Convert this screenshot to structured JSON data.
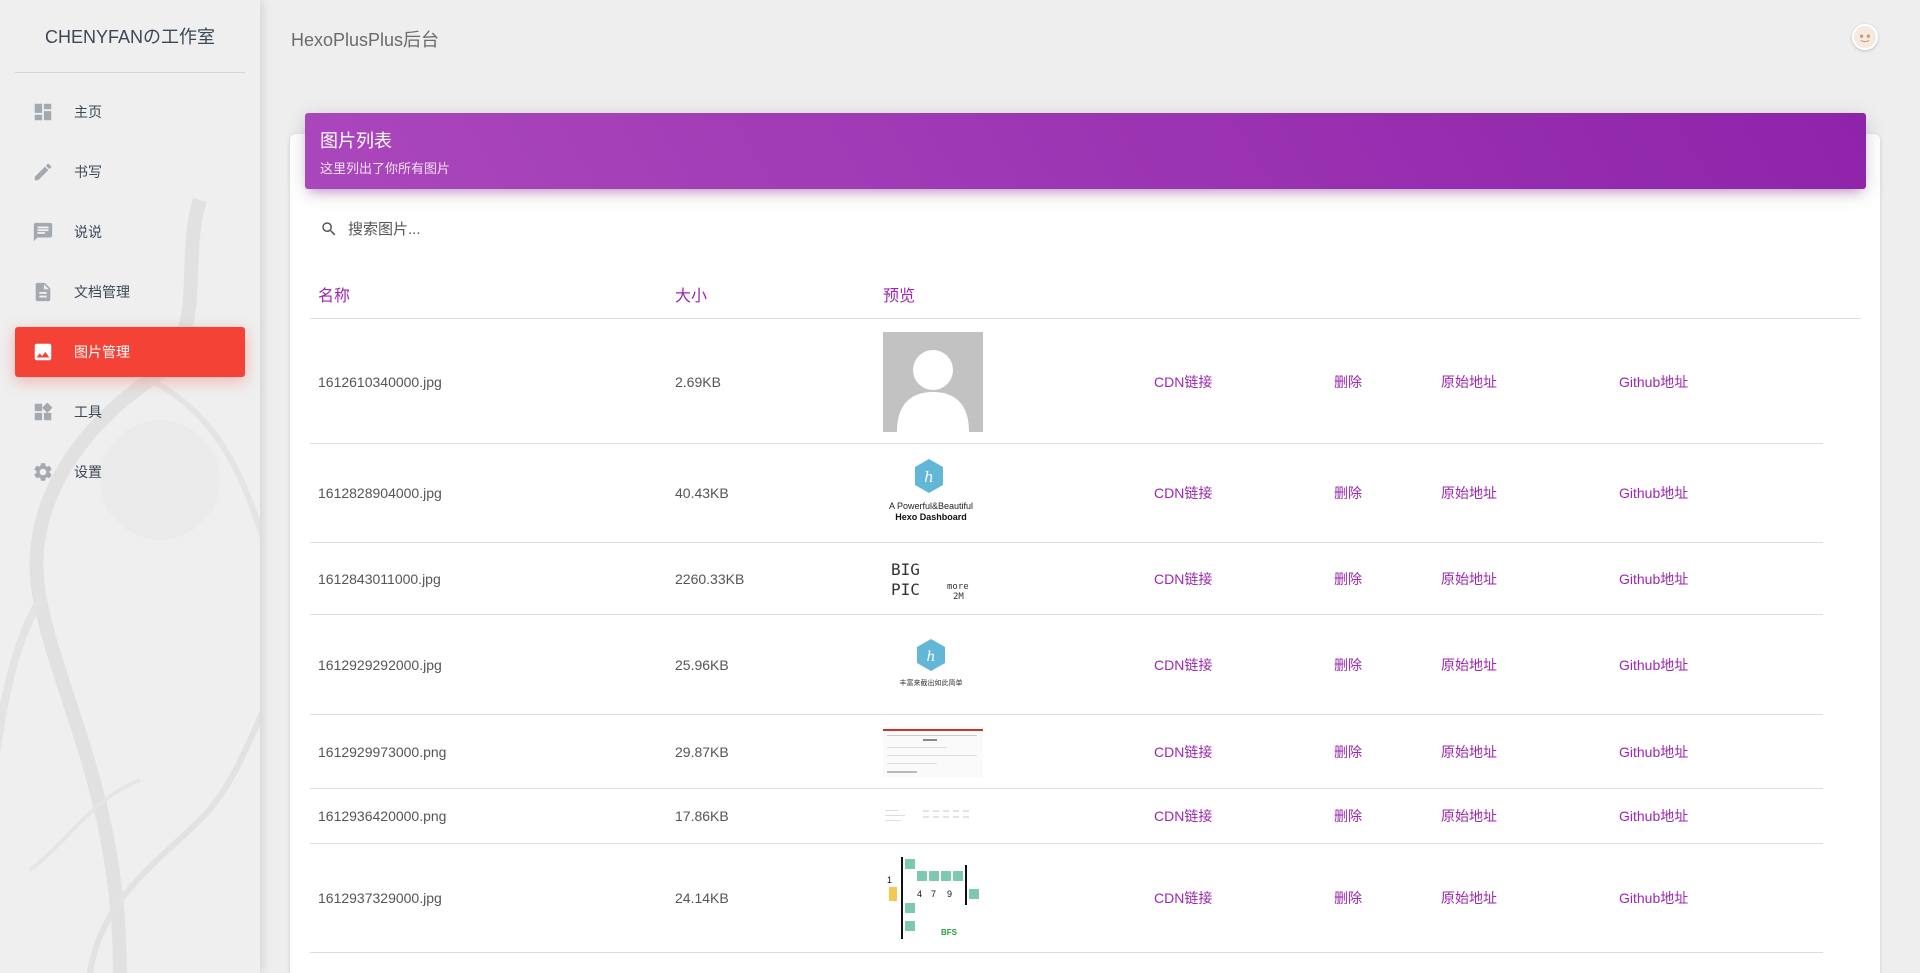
{
  "brand": "CHENYFANの工作室",
  "topbar": {
    "title": "HexoPlusPlus后台"
  },
  "nav": [
    {
      "label": "主页",
      "icon": "dashboard-icon"
    },
    {
      "label": "书写",
      "icon": "pencil-icon"
    },
    {
      "label": "说说",
      "icon": "chat-icon"
    },
    {
      "label": "文档管理",
      "icon": "document-icon"
    },
    {
      "label": "图片管理",
      "icon": "image-icon",
      "active": true
    },
    {
      "label": "工具",
      "icon": "widgets-icon"
    },
    {
      "label": "设置",
      "icon": "gear-icon"
    }
  ],
  "card": {
    "title": "图片列表",
    "subtitle": "这里列出了你所有图片",
    "search_placeholder": "搜索图片...",
    "columns": [
      "名称",
      "大小",
      "预览"
    ],
    "action_labels": {
      "cdn": "CDN链接",
      "delete": "删除",
      "origin": "原始地址",
      "github": "Github地址"
    },
    "rows": [
      {
        "name": "1612610340000.jpg",
        "size": "2.69KB",
        "preview": "default-avatar"
      },
      {
        "name": "1612828904000.jpg",
        "size": "40.43KB",
        "preview": "hexo-dashboard-logo",
        "preview_text": [
          "A Powerful&Beautiful",
          "Hexo Dashboard"
        ]
      },
      {
        "name": "1612843011000.jpg",
        "size": "2260.33KB",
        "preview": "big-pic-handwriting",
        "preview_text": [
          "BIG",
          "PIC",
          "more",
          "2M"
        ]
      },
      {
        "name": "1612929292000.jpg",
        "size": "25.96KB",
        "preview": "hexo-logo-small",
        "preview_text": [
          "丰富来截出如此简单"
        ]
      },
      {
        "name": "1612929973000.png",
        "size": "29.87KB",
        "preview": "screenshot-thumbnail"
      },
      {
        "name": "1612936420000.png",
        "size": "17.86KB",
        "preview": "screenshot-thumbnail-light"
      },
      {
        "name": "1612937329000.jpg",
        "size": "24.14KB",
        "preview": "bfs-diagram",
        "preview_text": [
          "1",
          "4",
          "7",
          "9",
          "BFS"
        ]
      }
    ]
  },
  "colors": {
    "accent": "#9c27b0",
    "header_gradient_start": "#ab47bc",
    "header_gradient_end": "#8e24aa",
    "active_nav": "#f44336",
    "hexo_logo": "#62b6d6"
  }
}
